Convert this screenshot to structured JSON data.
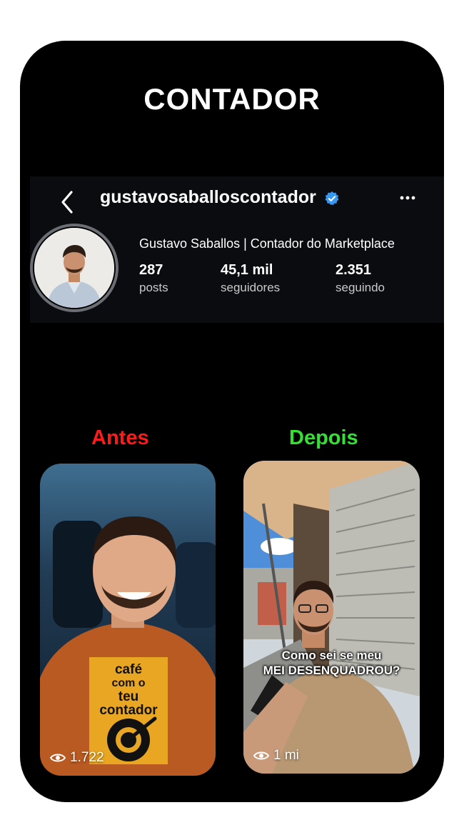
{
  "headline": "CONTADOR",
  "profile": {
    "username": "gustavosaballoscontador",
    "display_name": "Gustavo Saballos | Contador do Marketplace",
    "stats": [
      {
        "value": "287",
        "label": "posts"
      },
      {
        "value": "45,1 mil",
        "label": "seguidores"
      },
      {
        "value": "2.351",
        "label": "seguindo"
      }
    ]
  },
  "comparison": {
    "before_label": "Antes",
    "after_label": "Depois",
    "before_color": "#ff1a1a",
    "after_color": "#33e033"
  },
  "videos": [
    {
      "views": "1.722",
      "badge_lines": [
        "café",
        "com o",
        "teu",
        "contador"
      ]
    },
    {
      "views": "1 mi",
      "caption_lines": [
        "Como sei se meu",
        "MEI DESENQUADROU?"
      ]
    }
  ]
}
